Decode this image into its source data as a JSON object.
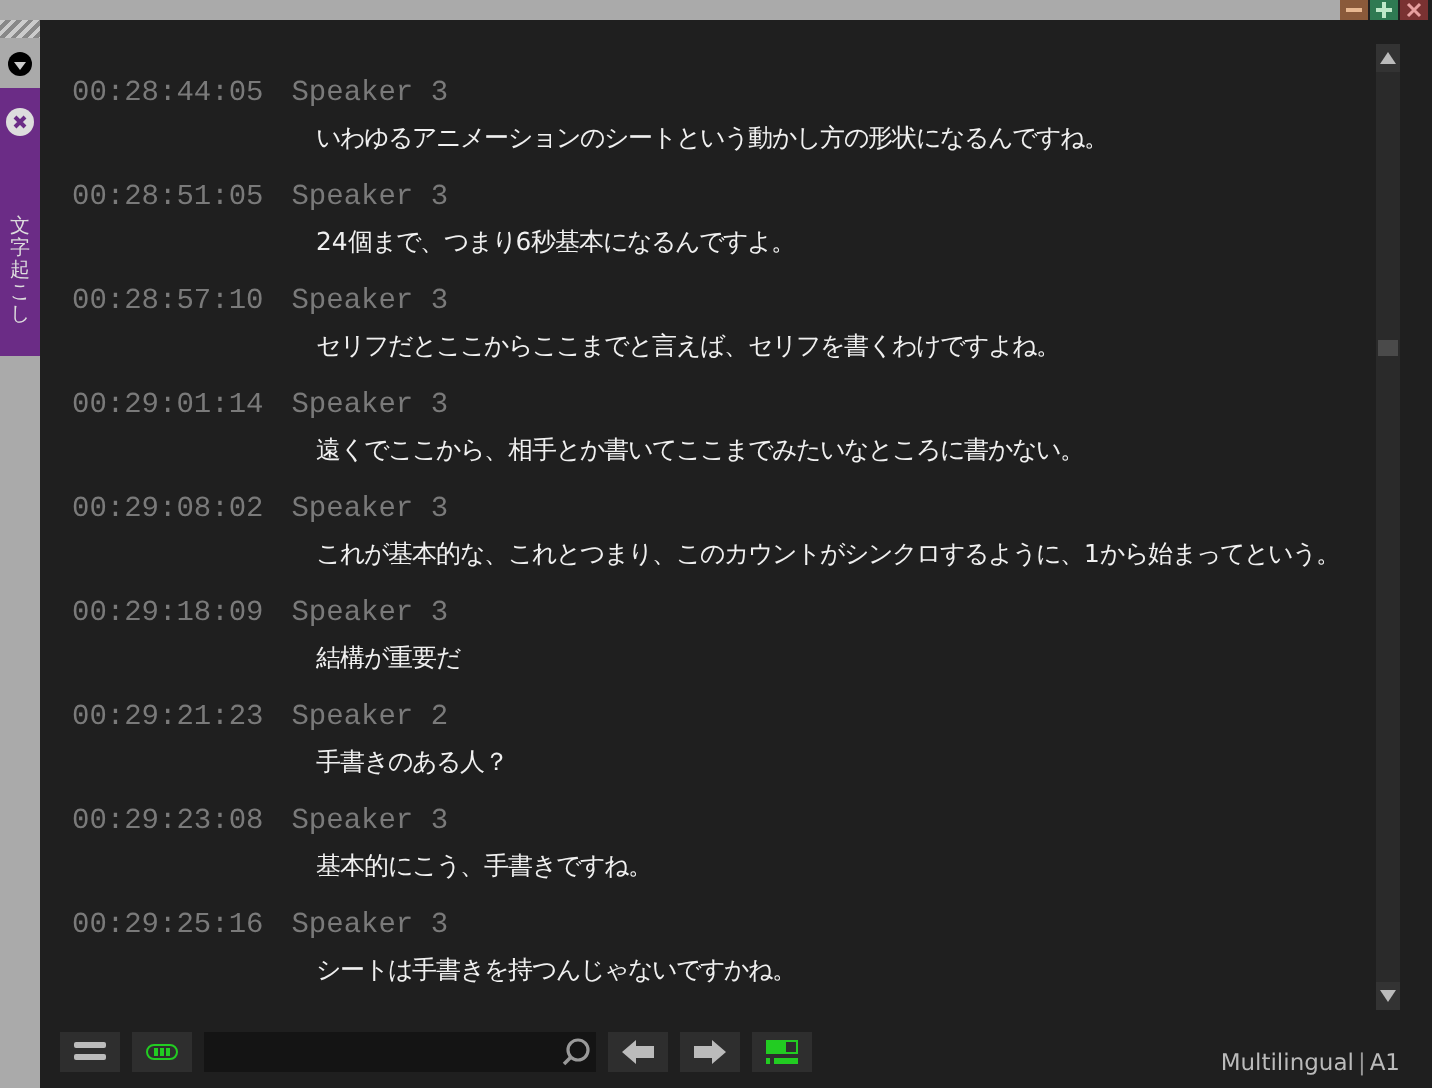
{
  "side_panel": {
    "label": "文字起こし"
  },
  "entries": [
    {
      "time": "00:28:44:05",
      "speaker": "Speaker 3",
      "text": "いわゆるアニメーションのシートという動かし方の形状になるんですね。"
    },
    {
      "time": "00:28:51:05",
      "speaker": "Speaker 3",
      "text": "24個まで、つまり6秒基本になるんですよ。"
    },
    {
      "time": "00:28:57:10",
      "speaker": "Speaker 3",
      "text": "セリフだとここからここまでと言えば、セリフを書くわけですよね。"
    },
    {
      "time": "00:29:01:14",
      "speaker": "Speaker 3",
      "text": "遠くでここから、相手とか書いてここまでみたいなところに書かない。"
    },
    {
      "time": "00:29:08:02",
      "speaker": "Speaker 3",
      "text": "これが基本的な、これとつまり、このカウントがシンクロするように、1から始まってという。"
    },
    {
      "time": "00:29:18:09",
      "speaker": "Speaker 3",
      "text": "結構が重要だ"
    },
    {
      "time": "00:29:21:23",
      "speaker": "Speaker 2",
      "text": "手書きのある人？"
    },
    {
      "time": "00:29:23:08",
      "speaker": "Speaker 3",
      "text": "基本的にこう、手書きですね。"
    },
    {
      "time": "00:29:25:16",
      "speaker": "Speaker 3",
      "text": "シートは手書きを持つんじゃないですかね。"
    }
  ],
  "status": {
    "language": "Multilingual",
    "separator": "|",
    "track": "A1"
  }
}
